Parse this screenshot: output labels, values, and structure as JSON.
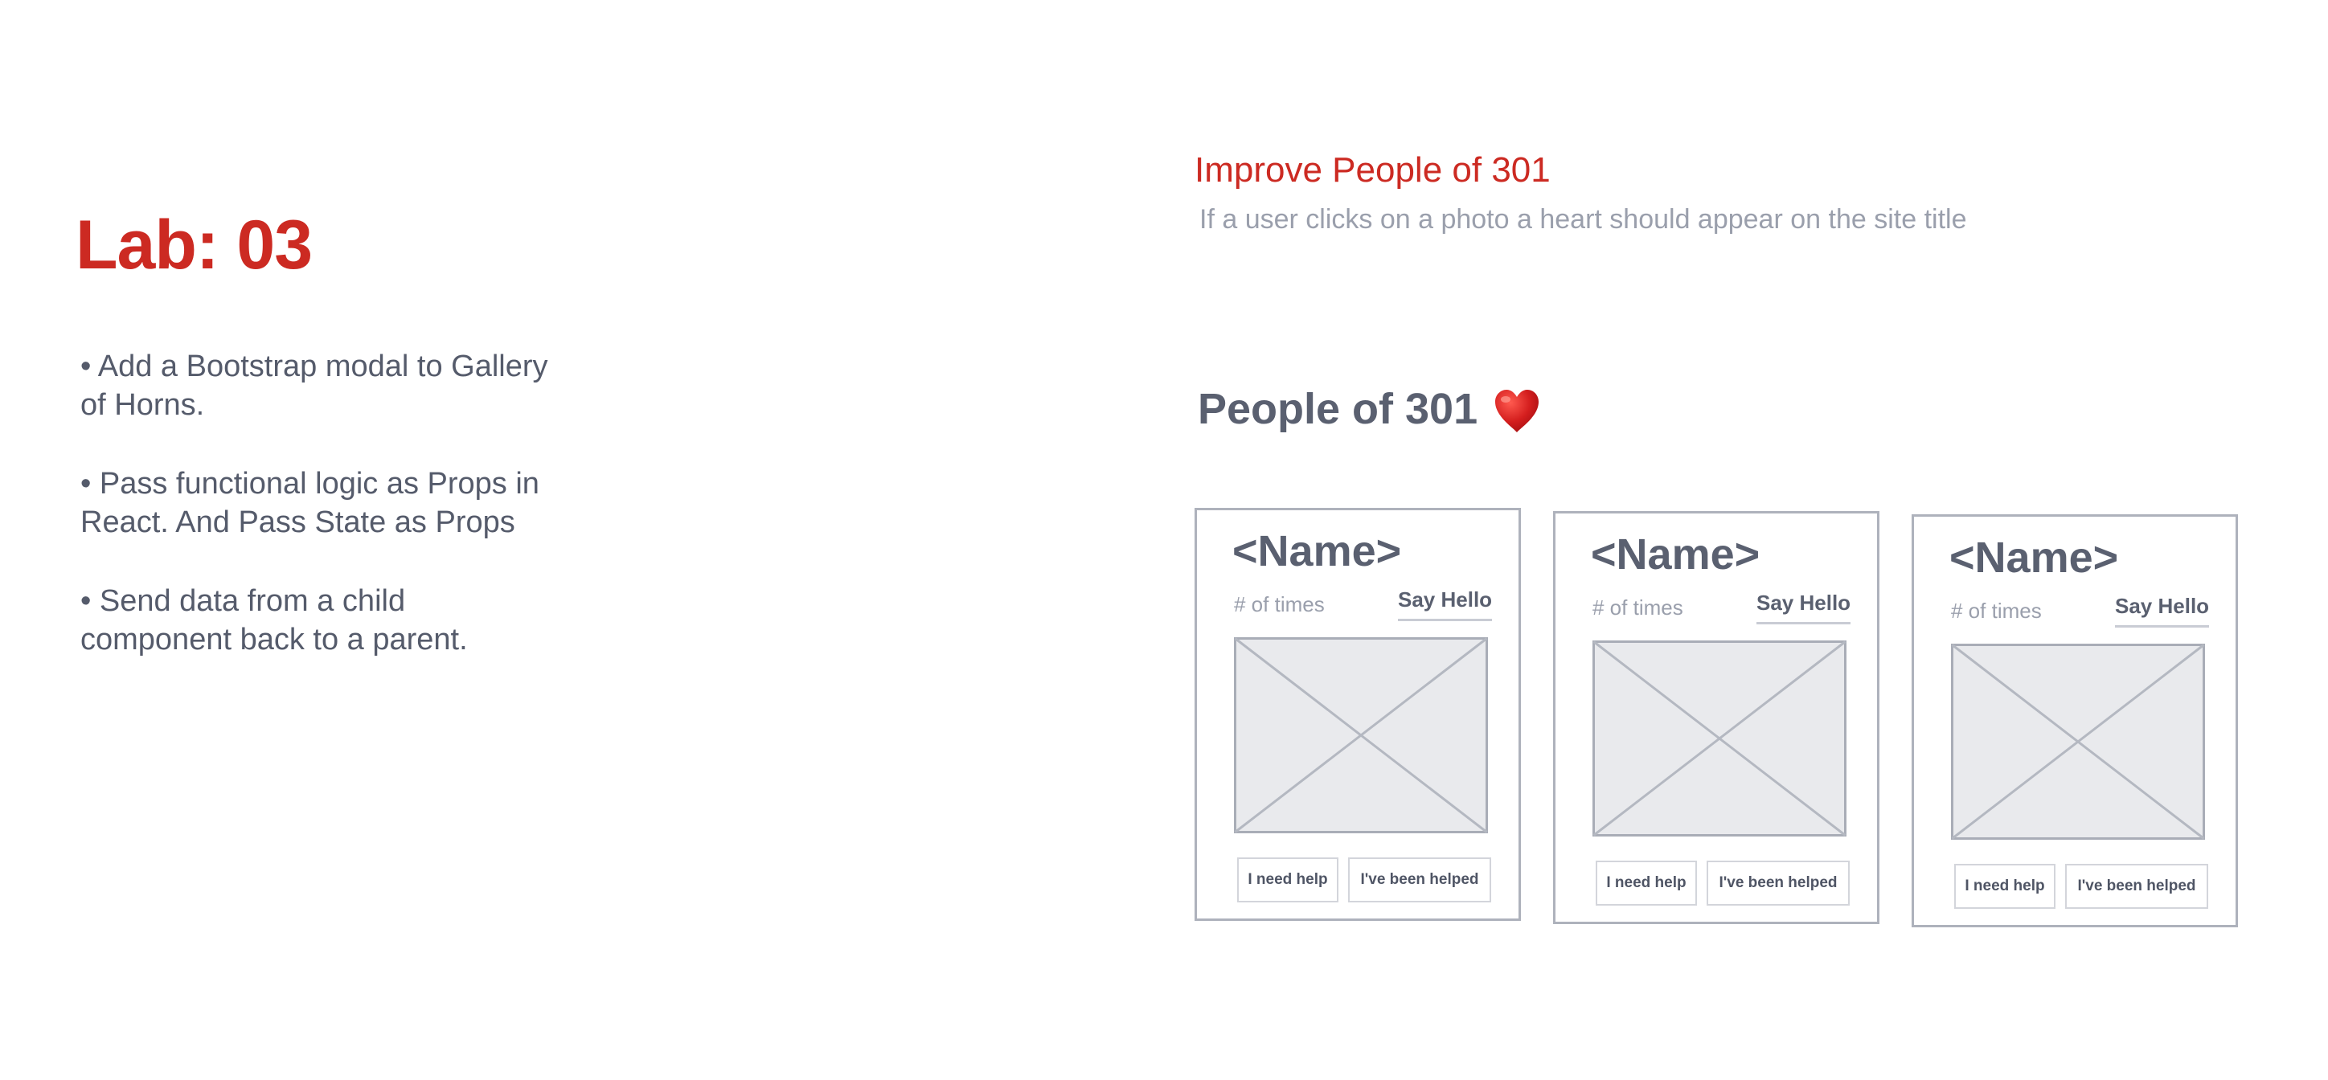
{
  "lab": {
    "title": "Lab: 03",
    "bullets": [
      "• Add a Bootstrap modal to Gallery of Horns.",
      "• Pass functional logic as Props in React. And Pass State as Props",
      "• Send data from a child component back to a parent."
    ]
  },
  "task": {
    "title": "Improve People of 301",
    "description": "If a user clicks on a photo a heart should appear on the site title"
  },
  "mockup": {
    "site_title": "People of 301",
    "heart_icon": "heart-icon",
    "cards": [
      {
        "name": "<Name>",
        "times_label": "# of times",
        "say_hello": "Say Hello",
        "image_icon": "image-placeholder-icon",
        "help_button": "I need help",
        "helped_button": "I've been helped"
      },
      {
        "name": "<Name>",
        "times_label": "# of times",
        "say_hello": "Say Hello",
        "image_icon": "image-placeholder-icon",
        "help_button": "I need help",
        "helped_button": "I've been helped"
      },
      {
        "name": "<Name>",
        "times_label": "# of times",
        "say_hello": "Say Hello",
        "image_icon": "image-placeholder-icon",
        "help_button": "I need help",
        "helped_button": "I've been helped"
      }
    ]
  },
  "colors": {
    "accent": "#cc2a22",
    "text": "#5a6070",
    "muted": "#9a9fac",
    "border": "#aeb2bc",
    "heart": "#c7191a"
  }
}
